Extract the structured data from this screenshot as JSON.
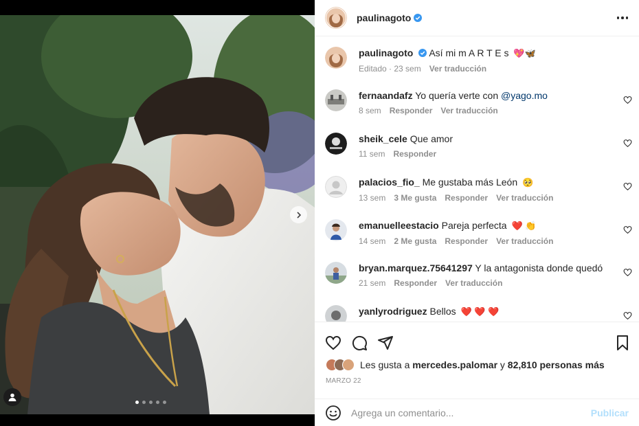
{
  "post": {
    "author": "paulinagoto",
    "verified": true,
    "caption": "Así mi m A R T E s",
    "caption_emojis": "💖🦋",
    "caption_meta_edited": "Editado · 23 sem",
    "caption_meta_translate": "Ver traducción",
    "carousel_dots": 5,
    "carousel_active": 0
  },
  "comments": [
    {
      "user": "fernaandafz",
      "text": "Yo quería verte con ",
      "mention": "@yago.mo",
      "emoji": "",
      "time": "8 sem",
      "likes": "",
      "reply": "Responder",
      "translate": "Ver traducción"
    },
    {
      "user": "sheik_cele",
      "text": "Que amor",
      "mention": "",
      "emoji": "",
      "time": "11 sem",
      "likes": "",
      "reply": "Responder",
      "translate": ""
    },
    {
      "user": "palacios_fio_",
      "text": "Me gustaba más León",
      "mention": "",
      "emoji": "🥺",
      "time": "13 sem",
      "likes": "3 Me gusta",
      "reply": "Responder",
      "translate": "Ver traducción"
    },
    {
      "user": "emanuelleestacio",
      "text": "Pareja perfecta",
      "mention": "",
      "emoji": "❤️ 👏",
      "time": "14 sem",
      "likes": "2 Me gusta",
      "reply": "Responder",
      "translate": "Ver traducción"
    },
    {
      "user": "bryan.marquez.75641297",
      "text": "Y la antagonista donde quedó",
      "mention": "",
      "emoji": "",
      "time": "21 sem",
      "likes": "",
      "reply": "Responder",
      "translate": "Ver traducción"
    },
    {
      "user": "yanlyrodriguez",
      "text": "Bellos",
      "mention": "",
      "emoji": "❤️ ❤️ ❤️",
      "time": "",
      "likes": "",
      "reply": "",
      "translate": ""
    }
  ],
  "likes": {
    "prefix": "Les gusta a",
    "first_user": "mercedes.palomar",
    "connector": "y",
    "others": "82,810 personas más"
  },
  "date": "MARZO 22",
  "composer": {
    "placeholder": "Agrega un comentario...",
    "publish_label": "Publicar"
  },
  "icons": {
    "like": "heart-icon",
    "comment": "comment-icon",
    "share": "share-icon",
    "save": "bookmark-icon",
    "emoji": "emoji-icon",
    "more": "more-options-icon",
    "next": "chevron-right-icon",
    "tag": "user-tag-icon"
  },
  "colors": {
    "verified": "#3897f0",
    "publish_disabled": "#b2dffc",
    "meta_gray": "#8e8e8e",
    "mention": "#00376b"
  }
}
